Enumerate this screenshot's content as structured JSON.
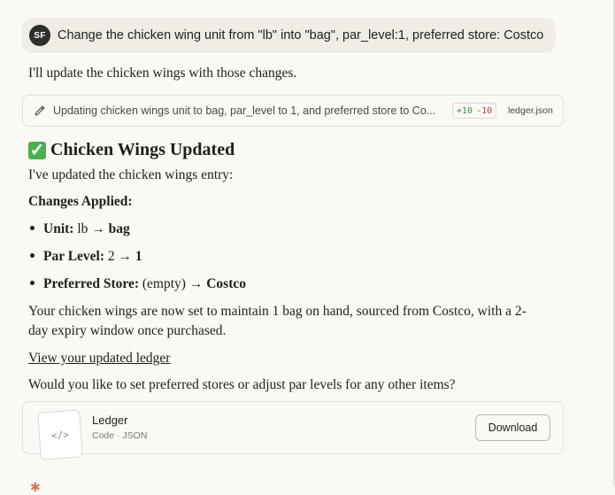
{
  "user_message": {
    "avatar_initials": "SF",
    "text": "Change the chicken wing unit from \"lb\" into \"bag\", par_level:1, preferred store: Costco"
  },
  "assistant": {
    "intro": "I'll update the chicken wings with those changes.",
    "tool_call": {
      "icon": "pencil-icon",
      "text": "Updating chicken wings unit to bag, par_level to 1, and preferred store to Co...",
      "additions": "+10",
      "deletions": "-10",
      "file": "ledger.json"
    },
    "heading_emoji": "✓",
    "heading": "Chicken Wings Updated",
    "updated_line": "I've updated the chicken wings entry:",
    "changes_label": "Changes Applied:",
    "changes": [
      {
        "label": "Unit:",
        "from": "lb",
        "arrow": "→",
        "to": "bag"
      },
      {
        "label": "Par Level:",
        "from": "2",
        "arrow": "→",
        "to": "1"
      },
      {
        "label": "Preferred Store:",
        "from": "(empty)",
        "arrow": "→",
        "to": "Costco"
      }
    ],
    "summary_line1": "Your chicken wings are now set to maintain 1 bag on hand, sourced from Costco, with a 2-",
    "summary_line2": "day expiry window once purchased.",
    "ledger_link": "View your updated ledger",
    "question": "Would you like to set preferred stores or adjust par levels for any other items?",
    "file_card": {
      "name": "Ledger",
      "meta": "Code · JSON",
      "thumb_glyph": "</>",
      "download_label": "Download"
    }
  },
  "colors": {
    "background": "#faf9f5",
    "user_bubble": "#efede6",
    "check_green": "#4caf50",
    "diff_add": "#3c8a3f",
    "diff_del": "#c2413a",
    "accent": "#d97757"
  }
}
